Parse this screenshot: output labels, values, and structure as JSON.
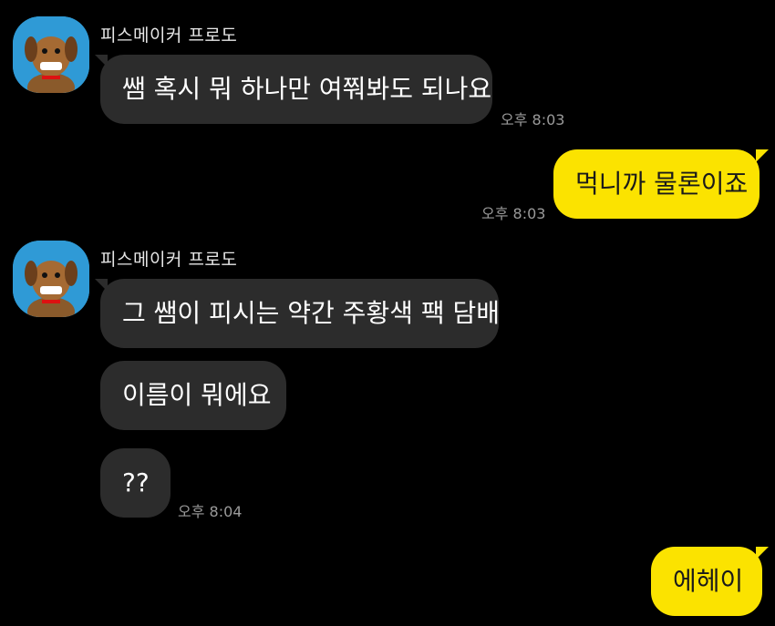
{
  "messages": {
    "group1": {
      "sender": "피스메이커 프로도",
      "text": "쌤 혹시 뭐 하나만 여쭤봐도 되나요",
      "time": "오후 8:03"
    },
    "reply1": {
      "text": "먹니까 물론이죠",
      "time": "오후 8:03"
    },
    "group2": {
      "sender": "피스메이커 프로도",
      "lines": [
        "그 쌤이 피시는 약간 주황색 팩 담배",
        "이름이 뭐에요",
        "??"
      ],
      "time": "오후 8:04"
    },
    "reply2": {
      "text": "에헤이"
    }
  },
  "colors": {
    "background": "#000000",
    "incoming_bubble": "#2c2c2c",
    "outgoing_bubble": "#fbe300",
    "avatar_bg": "#2f9ad6"
  }
}
